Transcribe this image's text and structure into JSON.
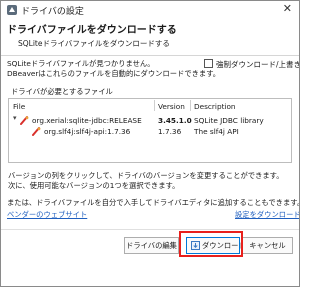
{
  "window": {
    "title": "ドライバの設定",
    "close_glyph": "✕"
  },
  "header": {
    "title": "ドライバファイルをダウンロードする",
    "description": "SQLiteドライバファイルをダウンロードする"
  },
  "message": {
    "line1": "SQLiteドライバファイルが見つかりません。",
    "line2": "DBeaverはこれらのファイルを自動的にダウンロードできます。"
  },
  "force_download": {
    "label": "強制ダウンロード/上書き",
    "checked": false
  },
  "files_group": {
    "label": "ドライバが必要とするファイル"
  },
  "table": {
    "columns": [
      "File",
      "Version",
      "Description"
    ],
    "rows": [
      {
        "file": "org.xerial:sqlite-jdbc:RELEASE",
        "version": "3.45.1.0",
        "description": "SQLite JDBC library",
        "expanded": true,
        "icon": "jar-icon"
      },
      {
        "file": "org.slf4j:slf4j-api:1.7.36",
        "version": "1.7.36",
        "description": "The slf4j API",
        "icon": "jar-icon"
      }
    ]
  },
  "notes": {
    "line1": "バージョンの列をクリックして、ドライバのバージョンを変更することができます。",
    "line2": "次に、使用可能なバージョンの1つを選択できます。",
    "line3": "または、ドライバファイルを自分で入手してドライバエディタに追加することもできます。"
  },
  "links": {
    "vendor": "ベンダーのウェブサイト",
    "settings": "設定をダウンロード"
  },
  "buttons": {
    "edit_driver": "ドライバの編集",
    "download": "ダウンロード",
    "cancel": "キャンセル"
  },
  "colors": {
    "accent": "#1f5fbf",
    "highlight": "#e8201c",
    "jar_icon": "#d9302c"
  }
}
